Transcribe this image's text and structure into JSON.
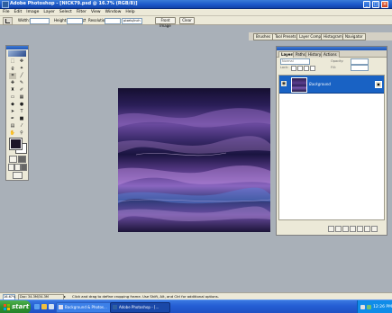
{
  "window": {
    "title": "Adobe Photoshop - [NICK79.psd @ 16.7% (RGB/8)]",
    "controls": {
      "minimize": "_",
      "maximize": "□",
      "close": "×"
    }
  },
  "menu": [
    "File",
    "Edit",
    "Image",
    "Layer",
    "Select",
    "Filter",
    "View",
    "Window",
    "Help"
  ],
  "options_bar": {
    "width_label": "Width:",
    "height_label": "Height:",
    "resolution_label": "Resolution:",
    "resolution_unit": "pixels/inch",
    "front_image_button": "Front Image",
    "clear_button": "Clear"
  },
  "palette_well": [
    "Brushes",
    "Tool Presets",
    "Layer Comps",
    "Histogram",
    "Navigator"
  ],
  "layers_palette": {
    "tabs": [
      "Layers",
      "Paths",
      "History",
      "Actions"
    ],
    "blend_mode": "Normal",
    "opacity_label": "Opacity:",
    "lock_label": "Lock:",
    "fill_label": "Fill:",
    "layer_name": "Background"
  },
  "status_bar": {
    "zoom": "16.67%",
    "doc_info": "Doc: 34.3M/34.3M",
    "hint": "Click and drag to define cropping frame. Use Shift, Alt, and Ctrl for additional options."
  },
  "taskbar": {
    "start_label": "start",
    "buttons": [
      {
        "label": "Background & Photos...",
        "active": false
      },
      {
        "label": "Adobe Photoshop - [...",
        "active": true
      }
    ],
    "clock": "12:26 PM"
  },
  "icons": {
    "eye": "visibility-eye-icon",
    "lock": "lock-icon"
  }
}
